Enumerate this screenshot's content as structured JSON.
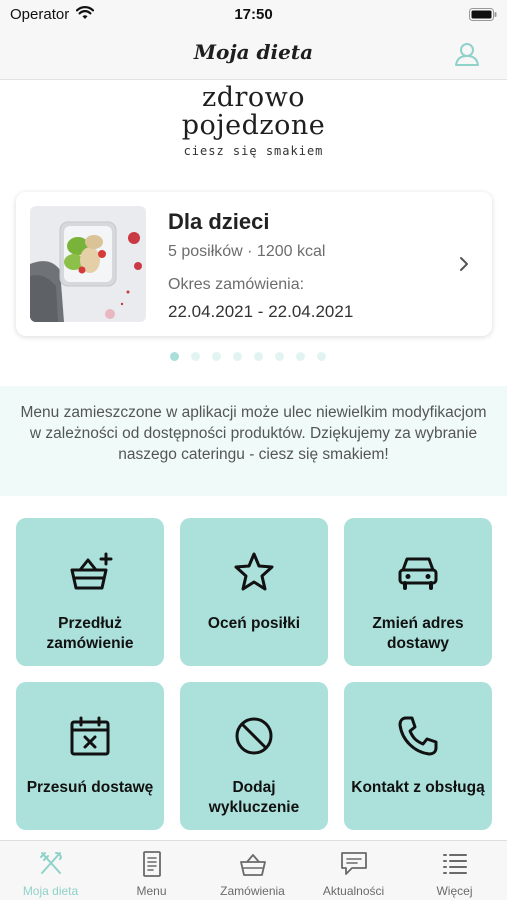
{
  "status_bar": {
    "carrier": "Operator",
    "time": "17:50"
  },
  "nav": {
    "title": "Moja dieta",
    "profile_icon": "person-icon"
  },
  "logo": {
    "line1": "zdrowo",
    "line2": "pojedzone",
    "tagline": "ciesz się smakiem"
  },
  "diet_card": {
    "name": "Dla dzieci",
    "meta": "5 posiłków · 1200 kcal",
    "period_label": "Okres zamówienia:",
    "period": "22.04.2021 - 22.04.2021"
  },
  "pager": {
    "count": 8,
    "active": 1
  },
  "notice": {
    "text": "Menu zamieszczone w aplikacji może ulec niewielkim modyfikacjom w zależności od dostępności produktów. Dziękujemy za wybranie naszego cateringu - ciesz się smakiem!"
  },
  "tiles": [
    {
      "label": "Przedłuż zamówienie",
      "icon": "basket-plus-icon"
    },
    {
      "label": "Oceń posiłki",
      "icon": "star-icon"
    },
    {
      "label": "Zmień adres dostawy",
      "icon": "car-icon"
    },
    {
      "label": "Przesuń dostawę",
      "icon": "calendar-x-icon"
    },
    {
      "label": "Dodaj wykluczenie",
      "icon": "prohibited-icon"
    },
    {
      "label": "Kontakt z obsługą",
      "icon": "phone-icon"
    }
  ],
  "tab_bar": {
    "items": [
      {
        "label": "Moja dieta",
        "icon": "cutlery-icon",
        "active": true
      },
      {
        "label": "Menu",
        "icon": "document-icon",
        "active": false
      },
      {
        "label": "Zamówienia",
        "icon": "basket-icon",
        "active": false
      },
      {
        "label": "Aktualności",
        "icon": "chat-icon",
        "active": false
      },
      {
        "label": "Więcej",
        "icon": "list-icon",
        "active": false
      }
    ]
  },
  "colors": {
    "accent": "#ace1db",
    "accent_dark": "#8fd2c9",
    "notice_bg": "#effaf9"
  }
}
